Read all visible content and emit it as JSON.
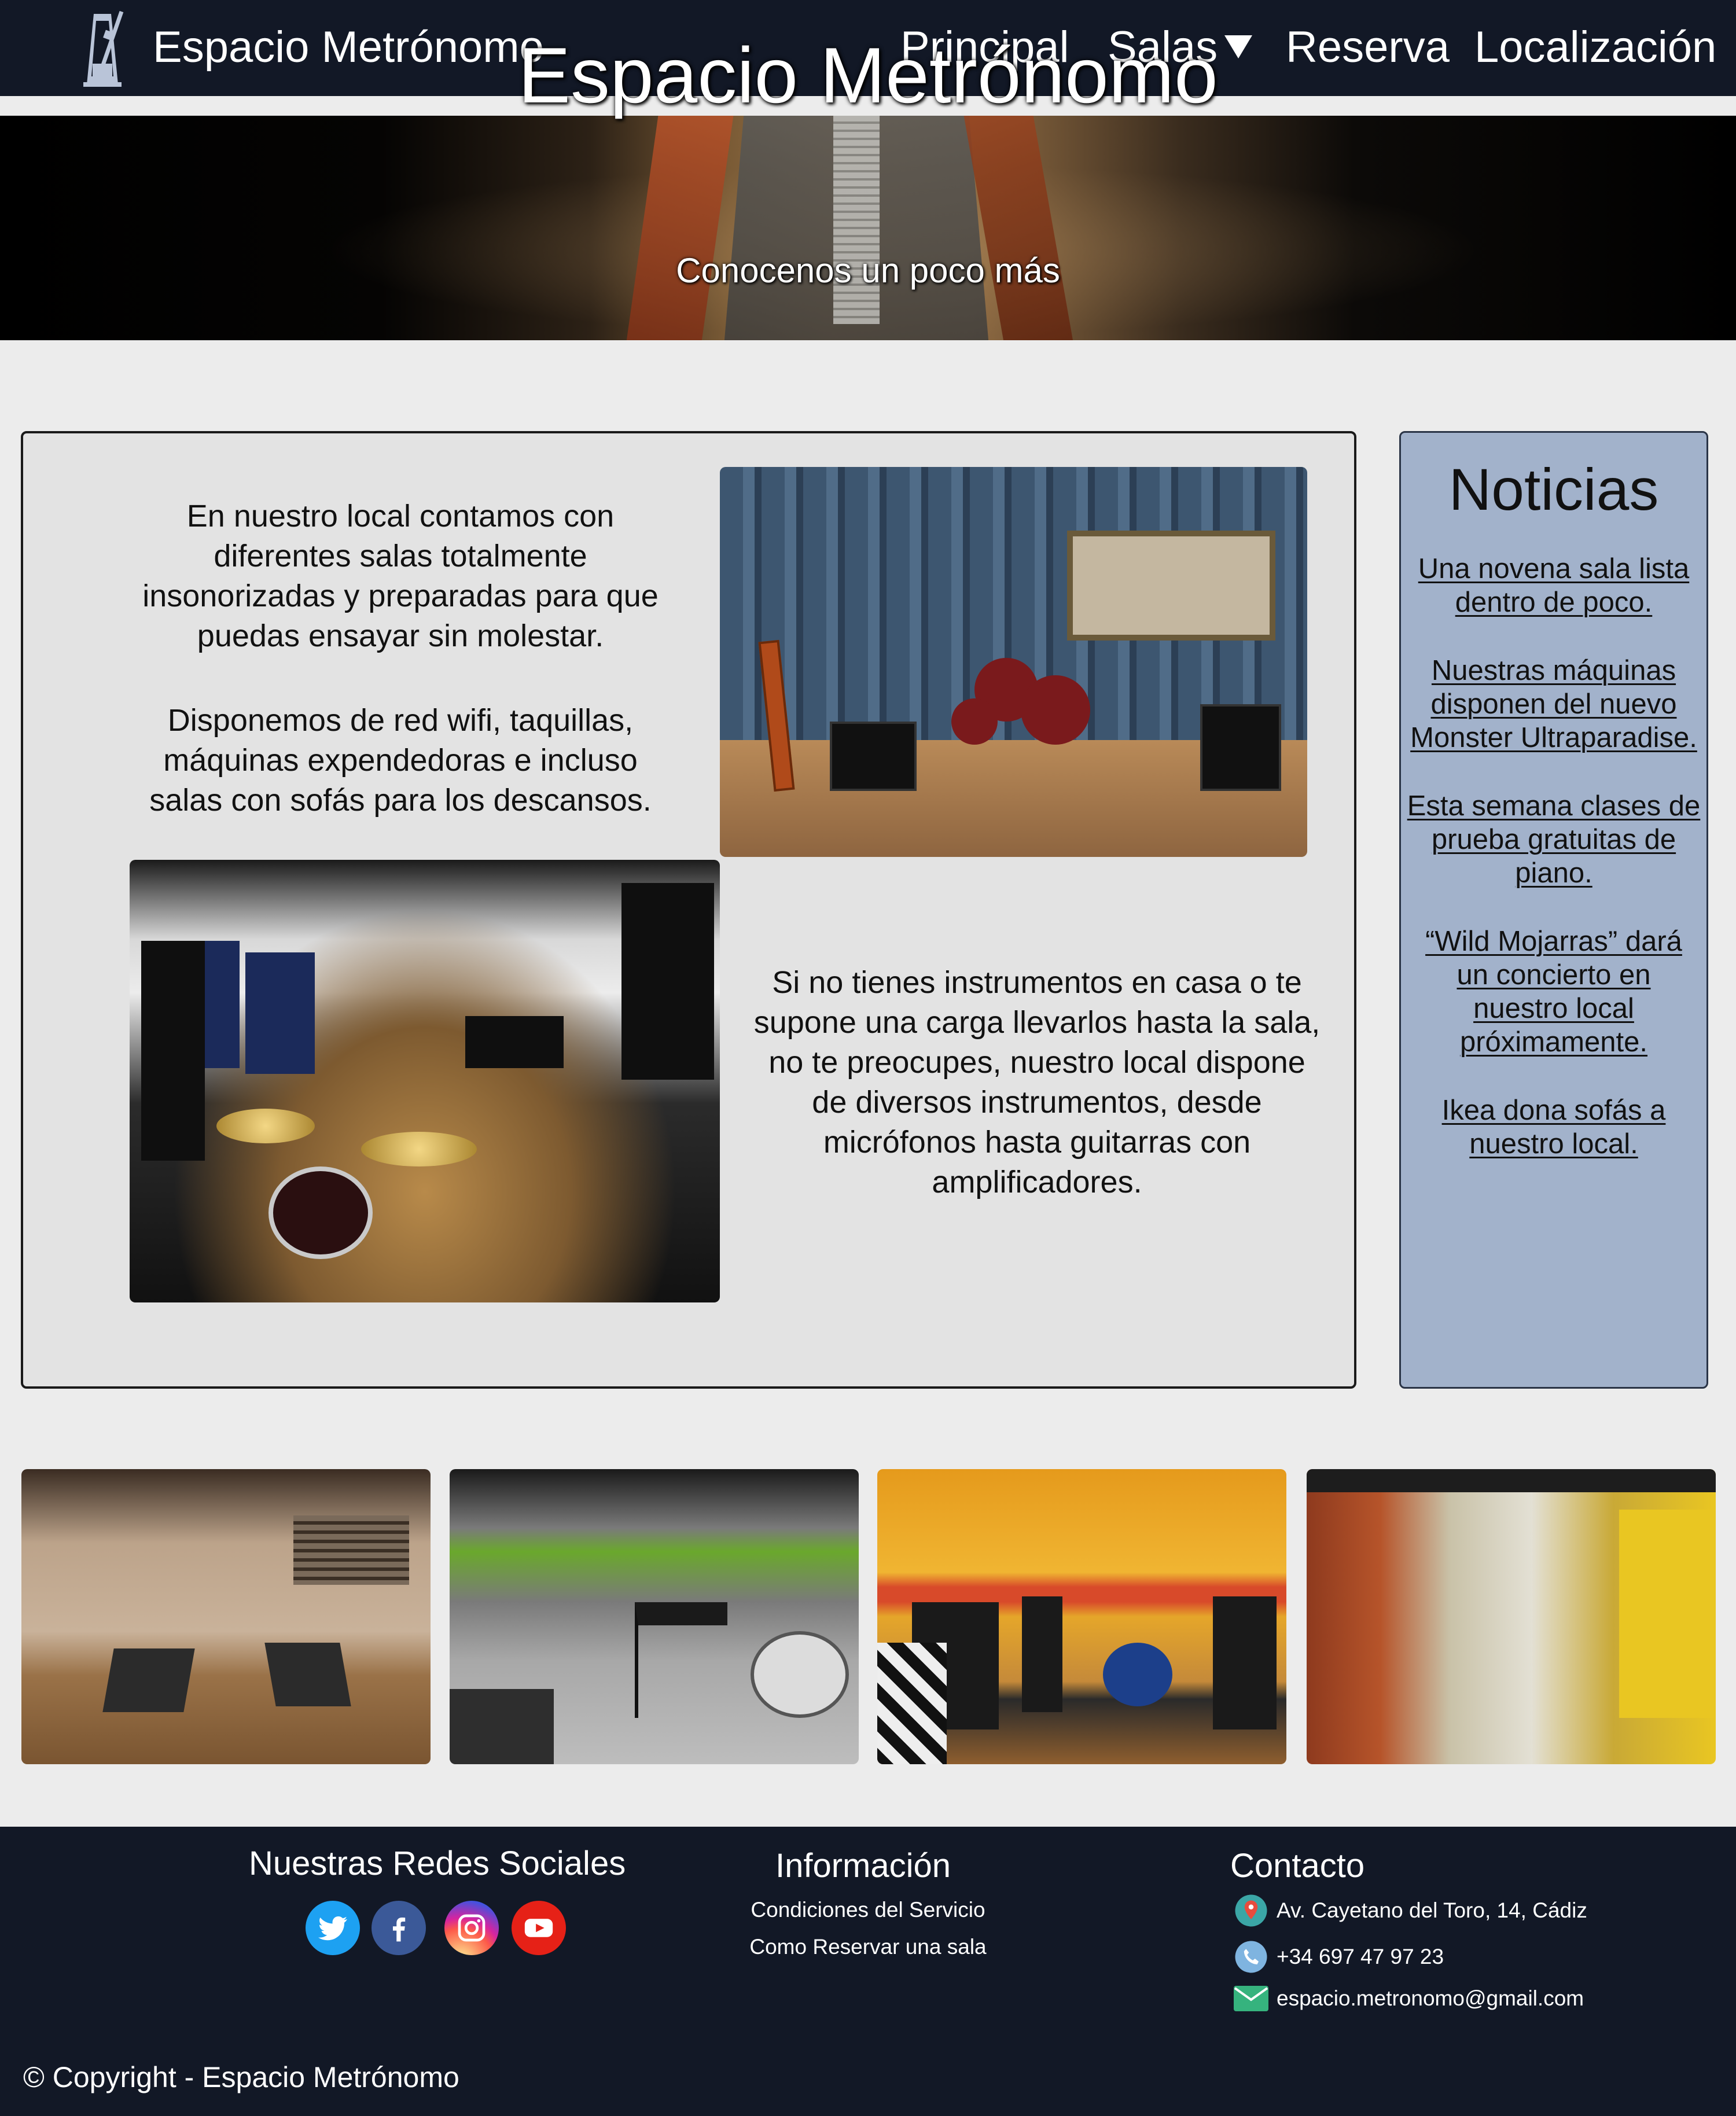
{
  "navbar": {
    "brand": "Espacio Metrónomo",
    "brand_icon": "metronome-icon",
    "items": [
      "Principal",
      "Salas",
      "Reserva",
      "Localización"
    ],
    "salas_icon": "caret-down-icon"
  },
  "hero": {
    "title": "Espacio Metrónomo",
    "subtitle": "Conocenos un poco más"
  },
  "main": {
    "intro_paragraphs": [
      "En nuestro local contamos con diferentes salas totalmente insonorizadas y preparadas para que puedas ensayar sin molestar.",
      "Disponemos de red wifi, taquillas, máquinas expendedoras e incluso salas con sofás para los descansos."
    ],
    "instruments_text": "Si no tienes instrumentos en casa o te supone una carga llevarlos hasta la sala, no te preocupes, nuestro local dispone de diversos instrumentos, desde micrófonos hasta guitarras con amplificadores."
  },
  "news": {
    "title": "Noticias",
    "items": [
      "Una novena sala lista dentro de poco.",
      "Nuestras máquinas disponen del nuevo Monster Ultraparadise.",
      "Esta semana clases de prueba gratuitas de piano.",
      "“Wild Mojarras” dará un concierto en nuestro local próximamente.",
      "Ikea dona sofás a nuestro local."
    ]
  },
  "footer": {
    "social_title": "Nuestras Redes Sociales",
    "social_icons": [
      "twitter-icon",
      "facebook-icon",
      "instagram-icon",
      "youtube-icon"
    ],
    "info_title": "Información",
    "info_links": [
      "Condiciones del Servicio",
      "Como Reservar una sala"
    ],
    "contact_title": "Contacto",
    "address": "Av. Cayetano del Toro, 14, Cádiz",
    "phone": "+34 697 47 97 23",
    "email": "espacio.metronomo@gmail.com",
    "copyright": "© Copyright - Espacio Metrónomo"
  },
  "colors": {
    "navbar_bg": "#121826",
    "page_bg": "#ececec",
    "news_bg": "#a2b2cb",
    "card_bg": "#e3e3e3"
  }
}
